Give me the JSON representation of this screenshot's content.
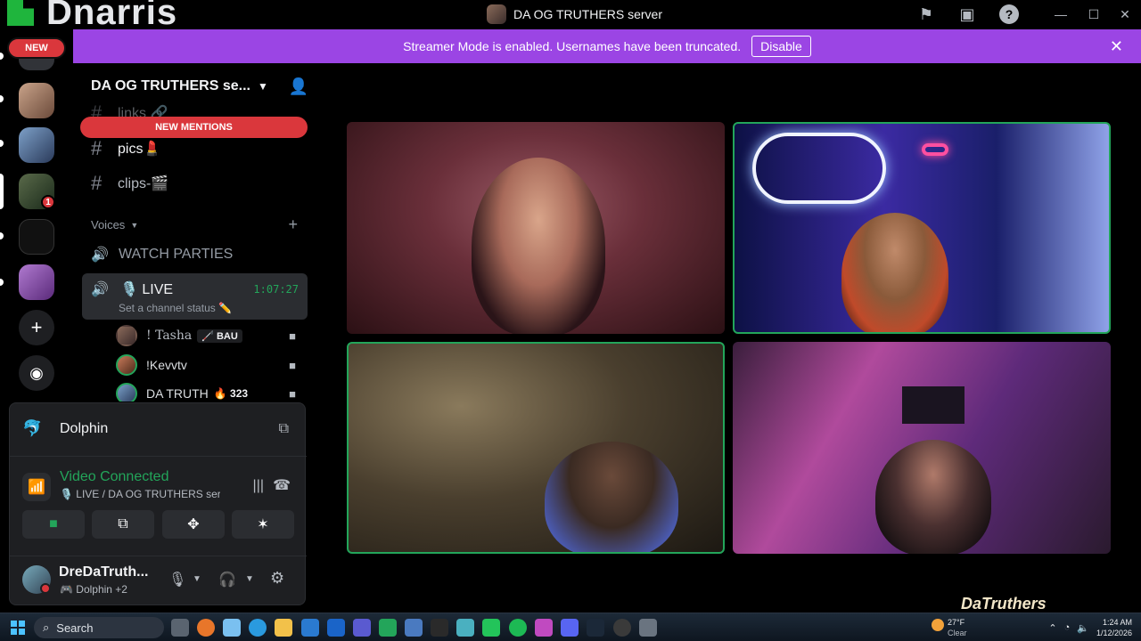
{
  "brand": {
    "name": "Dnarris",
    "new_badge": "NEW"
  },
  "window": {
    "title": "DA OG TRUTHERS server"
  },
  "banner": {
    "text": "Streamer Mode is enabled. Usernames have been truncated.",
    "button": "Disable"
  },
  "rail": {
    "mention_count": "1",
    "add_label": "+",
    "colors": {
      "mention": "#da373c"
    }
  },
  "guild": {
    "name": "DA OG TRUTHERS se...",
    "new_mentions": "NEW MENTIONS"
  },
  "channels": [
    {
      "name": "links 🔗"
    },
    {
      "name": "pics💄"
    },
    {
      "name": "clips-🎬"
    }
  ],
  "voice": {
    "category": "Voices",
    "watch_parties": "WATCH PARTIES",
    "live": {
      "name": "🎙️ LIVE",
      "timer": "1:07:27",
      "status": "Set a channel status ✏️"
    },
    "members": [
      {
        "name": "! Tasha",
        "tag": "🦯 BAU"
      },
      {
        "name": "!Kevvtv",
        "tag": ""
      },
      {
        "name": "DA TRUTH",
        "count": "🔥 323"
      }
    ]
  },
  "panel": {
    "activity": "Dolphin",
    "rtc_state": "Video Connected",
    "rtc_sub": "🎙️ LIVE / DA OG TRUTHERS ser...",
    "user": {
      "name": "DreDaTruth...",
      "status": "🎮 Dolphin +2"
    }
  },
  "tiles": [
    {
      "speaking": false
    },
    {
      "speaking": true
    },
    {
      "speaking": true
    },
    {
      "speaking": false
    }
  ],
  "taskbar": {
    "search": "Search",
    "weather_temp": "27°F",
    "weather_cond": "Clear",
    "time": "1:24 AM",
    "date": "1/12/2026"
  },
  "watermark": "DaTruthers",
  "colors": {
    "accent_green": "#23a55a",
    "banner_purple": "#9b45e4",
    "danger": "#da373c"
  }
}
